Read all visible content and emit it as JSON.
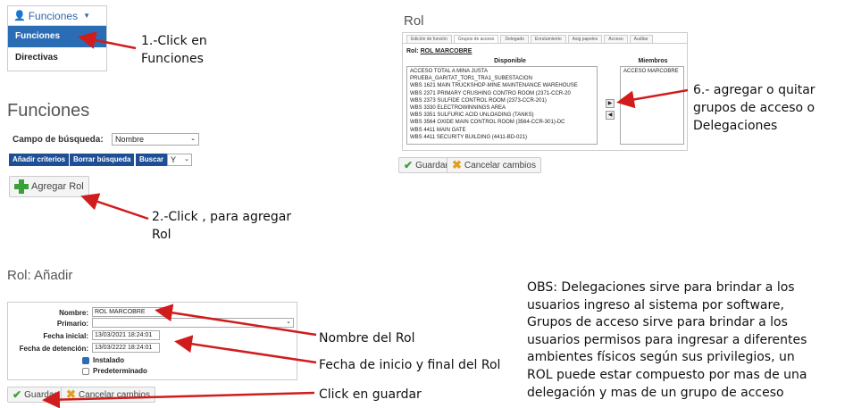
{
  "menu": {
    "top_label": "Funciones",
    "items": [
      "Funciones",
      "Directivas"
    ]
  },
  "step1": [
    "1.-Click en",
    "Funciones"
  ],
  "funciones_page": {
    "title": "Funciones",
    "search_label": "Campo de búsqueda:",
    "search_value": "Nombre",
    "buttons": [
      "Añadir criterios",
      "Borrar búsqueda",
      "Buscar"
    ],
    "logic_value": "Y",
    "add_button": "Agregar Rol"
  },
  "step2": [
    "2.-Click , para agregar",
    "Rol"
  ],
  "rol_panel": {
    "title": "Rol",
    "tabs": [
      "Edición de función",
      "Grupos de acceso",
      "Delegado",
      "Enrutamiento",
      "Asig papeles",
      "Acceso",
      "Auditar"
    ],
    "rol_label": "Rol:",
    "rol_name": "ROL MARCOBRE",
    "available_header": "Disponible",
    "members_header": "Miembros",
    "available": [
      "ACCESO TOTAL A MINA JUSTA",
      "PRUEBA_GARITAT_TOR1_TRA1_SUBESTACION",
      "WBS 1621 MAIN TRUCKSHOP-MINE MAINTENANCE WAREHOUSE",
      "WBS 2371 PRIMARY CRUSHING CONTRO ROOM (2371-CCR-20",
      "WBS 2373 SULFIDE CONTROL ROOM (2373-CCR-201)",
      "WBS 3330 ELECTROWINNINGS AREA",
      "WBS 3351 SULFURIC ACID UNLOADING (TANKS)",
      "WBS 3564 OXIDE MAIN CONTROL ROOM (3564-CCR-301)-DC",
      "WBS 4411 MAIN GATE",
      "WBS 4411 SECURITY BUILDING (4411-BD-021)"
    ],
    "members": [
      "ACCESO MARCOBRE"
    ],
    "save": "Guardar",
    "cancel": "Cancelar cambios"
  },
  "step6": [
    "6.- agregar o quitar",
    "grupos de acceso o",
    "Delegaciones"
  ],
  "add_form": {
    "title": "Rol: Añadir",
    "labels": [
      "Nombre:",
      "Primario:",
      "Fecha inicial:",
      "Fecha de detención:"
    ],
    "nombre": "ROL MARCOBRE",
    "primario": "",
    "fecha_inicial": "13/03/2021 18:24:01",
    "fecha_detencion": "13/03/2222 18:24:01",
    "instalado": "Instalado",
    "predeterminado": "Predeterminado",
    "save": "Guardar",
    "cancel": "Cancelar cambios"
  },
  "notes": {
    "nombre_rol": "Nombre del Rol",
    "fechas": "Fecha de inicio y final del Rol",
    "guardar": "Click en guardar"
  },
  "obs": [
    "OBS: Delegaciones sirve para brindar a los",
    "usuarios ingreso al sistema por software,",
    "Grupos de acceso sirve para brindar a los",
    "usuarios permisos para ingresar a diferentes",
    "ambientes físicos según sus privilegios, un",
    "ROL puede estar compuesto por mas de una",
    "delegación y mas de un grupo de acceso"
  ],
  "colors": {
    "annotation_arrow": "#d01c1c",
    "menu_active": "#2a6db5",
    "button_blue": "#1e4f96"
  }
}
